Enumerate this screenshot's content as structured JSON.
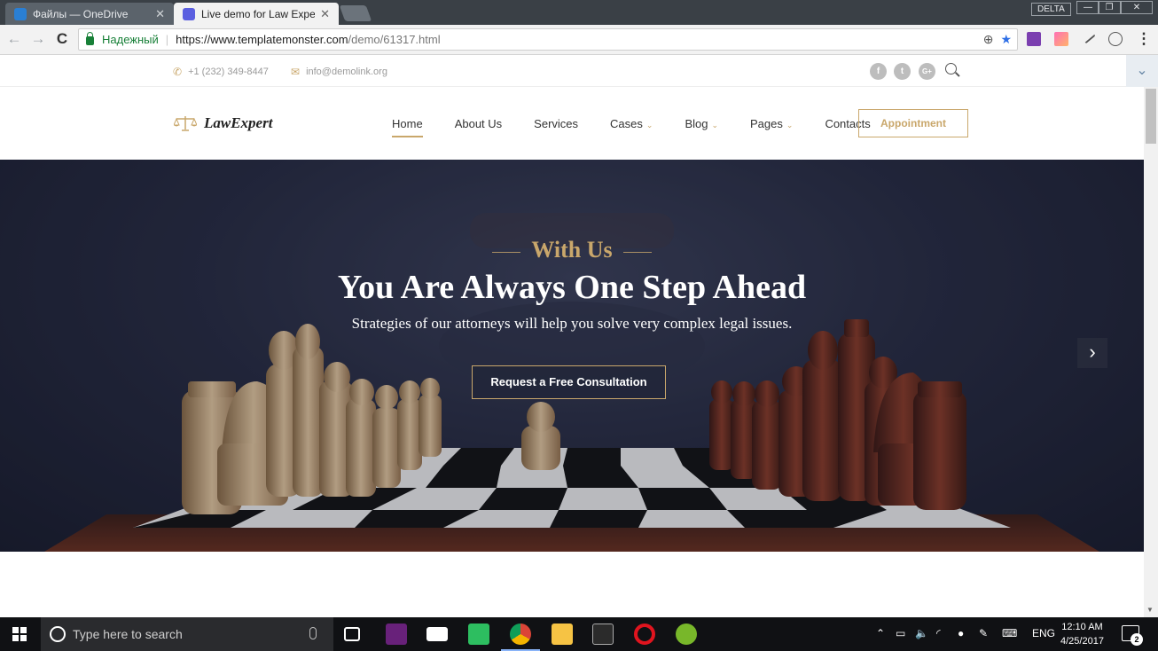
{
  "browser": {
    "tabs": [
      {
        "title": "Файлы — OneDrive",
        "icon": "onedrive-icon",
        "active": false
      },
      {
        "title": "Live demo for Law Expert",
        "icon": "templatemonster-icon",
        "active": true
      }
    ],
    "profile": "DELTA",
    "window_controls": {
      "minimize": "—",
      "restore": "❐",
      "close": "✕"
    },
    "nav": {
      "back": "←",
      "forward": "→",
      "reload": "C"
    },
    "security_label": "Надежный",
    "url_host": "https://www.templatemonster.com",
    "url_path": "/demo/61317.html",
    "zoom_icon": "⊕",
    "bookmark_icon": "★",
    "extensions": [
      "onenote-icon",
      "paint-icon",
      "pen-icon",
      "shield-icon"
    ],
    "menu_icon": "⋮"
  },
  "site": {
    "topbar": {
      "phone": "+1 (232) 349-8447",
      "email": "info@demolink.org",
      "social": [
        "f",
        "t",
        "G+"
      ]
    },
    "logo": "LawExpert",
    "menu": [
      {
        "label": "Home",
        "active": true,
        "dropdown": false
      },
      {
        "label": "About Us",
        "active": false,
        "dropdown": false
      },
      {
        "label": "Services",
        "active": false,
        "dropdown": false
      },
      {
        "label": "Cases",
        "active": false,
        "dropdown": true
      },
      {
        "label": "Blog",
        "active": false,
        "dropdown": true
      },
      {
        "label": "Pages",
        "active": false,
        "dropdown": true
      },
      {
        "label": "Contacts",
        "active": false,
        "dropdown": false
      }
    ],
    "appointment": "Appointment",
    "hero": {
      "kicker": "With Us",
      "title": "You Are Always One Step Ahead",
      "subtitle": "Strategies of our attorneys will help you solve very complex legal issues.",
      "cta": "Request a Free Consultation",
      "next_arrow": "›"
    },
    "accent_color": "#c9a76b"
  },
  "taskbar": {
    "search_placeholder": "Type here to search",
    "apps": [
      "task-view-icon",
      "visual-studio-icon",
      "mail-icon",
      "evernote-icon",
      "chrome-icon",
      "file-explorer-icon",
      "terminal-icon",
      "opera-icon",
      "utorrent-icon"
    ],
    "language": "ENG",
    "time": "12:10 AM",
    "date": "4/25/2017",
    "notifications": "2"
  }
}
